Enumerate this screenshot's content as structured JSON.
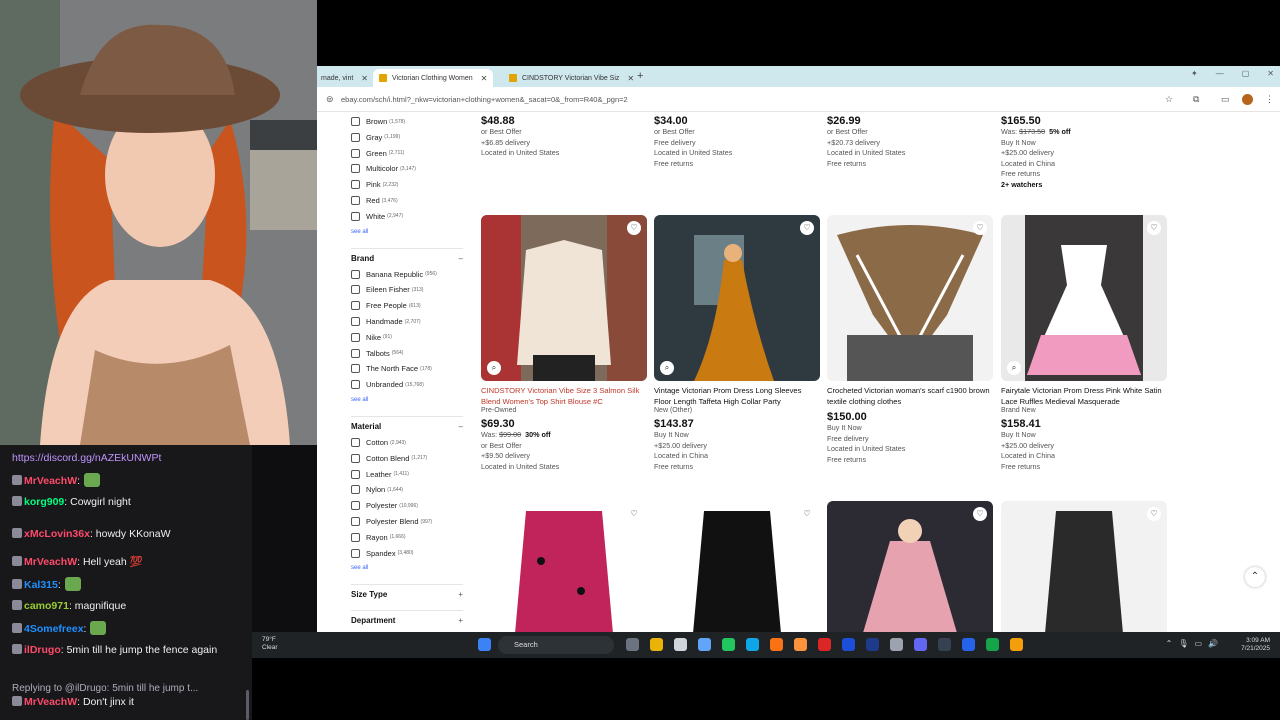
{
  "browser": {
    "tabs": [
      {
        "label": "made, vint"
      },
      {
        "label": "Victorian Clothing Women"
      },
      {
        "label": "CINDSTORY Victorian Vibe Siz"
      }
    ],
    "url": "ebay.com/sch/i.html?_nkw=victorian+clothing+women&_sacat=0&_from=R40&_pgn=2"
  },
  "sidebar": {
    "colors": [
      {
        "label": "Brown",
        "count": "(1,578)"
      },
      {
        "label": "Gray",
        "count": "(1,199)"
      },
      {
        "label": "Green",
        "count": "(2,711)"
      },
      {
        "label": "Multicolor",
        "count": "(3,147)"
      },
      {
        "label": "Pink",
        "count": "(2,232)"
      },
      {
        "label": "Red",
        "count": "(3,476)"
      },
      {
        "label": "White",
        "count": "(2,947)"
      }
    ],
    "see_all": "see all",
    "brand_heading": "Brand",
    "brands": [
      {
        "label": "Banana Republic",
        "count": "(956)"
      },
      {
        "label": "Eileen Fisher",
        "count": "(313)"
      },
      {
        "label": "Free People",
        "count": "(613)"
      },
      {
        "label": "Handmade",
        "count": "(2,707)"
      },
      {
        "label": "Nike",
        "count": "(91)"
      },
      {
        "label": "Talbots",
        "count": "(564)"
      },
      {
        "label": "The North Face",
        "count": "(178)"
      },
      {
        "label": "Unbranded",
        "count": "(15,768)"
      }
    ],
    "material_heading": "Material",
    "materials": [
      {
        "label": "Cotton",
        "count": "(2,943)"
      },
      {
        "label": "Cotton Blend",
        "count": "(1,217)"
      },
      {
        "label": "Leather",
        "count": "(1,411)"
      },
      {
        "label": "Nylon",
        "count": "(1,644)"
      },
      {
        "label": "Polyester",
        "count": "(10,996)"
      },
      {
        "label": "Polyester Blend",
        "count": "(997)"
      },
      {
        "label": "Rayon",
        "count": "(1,666)"
      },
      {
        "label": "Spandex",
        "count": "(3,480)"
      }
    ],
    "size_type_heading": "Size Type",
    "department_heading": "Department",
    "toggle_minus": "–",
    "toggle_plus": "+"
  },
  "top_row": [
    {
      "price": "$48.88",
      "lines": [
        "or Best Offer",
        "+$6.85 delivery",
        "Located in United States"
      ]
    },
    {
      "price": "$34.00",
      "lines": [
        "or Best Offer",
        "Free delivery",
        "Located in United States",
        "Free returns"
      ]
    },
    {
      "price": "$26.99",
      "lines": [
        "or Best Offer",
        "+$20.73 delivery",
        "Located in United States",
        "Free returns"
      ]
    },
    {
      "price": "$165.50",
      "was": "$173.50",
      "off": "5% off",
      "lines": [
        "Buy It Now",
        "+$25.00 delivery",
        "Located in China",
        "Free returns"
      ],
      "watchers": "2+ watchers"
    }
  ],
  "listings": [
    {
      "title": "CINDSTORY Victorian Vibe Size 3 Salmon Silk Blend Women's Top Shirt Blouse #C",
      "condition": "Pre-Owned",
      "price": "$69.30",
      "was": "$99.00",
      "off": "30% off",
      "lines": [
        "or Best Offer",
        "+$9.50 delivery",
        "Located in United States"
      ]
    },
    {
      "title": "Vintage Victorian Prom Dress Long Sleeves Floor Length Taffeta High Collar Party",
      "condition": "New (Other)",
      "price": "$143.87",
      "lines": [
        "Buy It Now",
        "+$25.00 delivery",
        "Located in China",
        "Free returns"
      ]
    },
    {
      "title": "Crocheted Victorian woman's scarf c1900 brown textile clothing clothes",
      "condition": "",
      "price": "$150.00",
      "lines": [
        "Buy It Now",
        "Free delivery",
        "Located in United States",
        "Free returns"
      ]
    },
    {
      "title": "Fairytale Victorian Prom Dress Pink White Satin Lace Ruffles Medieval Masquerade",
      "condition": "Brand New",
      "price": "$158.41",
      "lines": [
        "Buy It Now",
        "+$25.00 delivery",
        "Located in China",
        "Free returns"
      ]
    }
  ],
  "icons": {
    "heart": "♡",
    "zoom": "⌕",
    "scroll_up": "⌃"
  },
  "taskbar": {
    "temp": "79°F",
    "weather": "Clear",
    "search": "Search",
    "time": "3:09 AM",
    "date": "7/21/2025"
  },
  "chat": [
    {
      "user": "",
      "text": "https://discord.gg/nAZEkUNWPt",
      "user_color": "",
      "text_color": "#bf94ff"
    },
    {
      "user": "MrVeachW",
      "text": "",
      "user_color": "#ff4a6a"
    },
    {
      "user": "korg909",
      "text": "Cowgirl night",
      "user_color": "#00ff7f"
    },
    {
      "user": "xMcLovin36x",
      "text": "howdy KKonaW",
      "user_color": "#ff4a6a"
    },
    {
      "user": "MrVeachW",
      "text": "Hell yeah 💯",
      "user_color": "#ff4a6a"
    },
    {
      "user": "Kal315",
      "text": "",
      "user_color": "#1e90ff"
    },
    {
      "user": "camo971",
      "text": "magnifique",
      "user_color": "#9acd32"
    },
    {
      "user": "4Somefreex",
      "text": "",
      "user_color": "#1e90ff"
    },
    {
      "user": "ilDrugo",
      "text": "5min till he jump the fence again",
      "user_color": "#ff4a6a"
    },
    {
      "reply": "Replying to @ilDrugo: 5min till he jump t..."
    },
    {
      "user": "MrVeachW",
      "text": "Don't jinx it",
      "user_color": "#ff4a6a"
    }
  ],
  "colors": {
    "ebay_link": "#3665f3",
    "visited_title": "#c0392b",
    "chat_bg": "#18181b",
    "taskbar_bg": "#1f2326"
  }
}
